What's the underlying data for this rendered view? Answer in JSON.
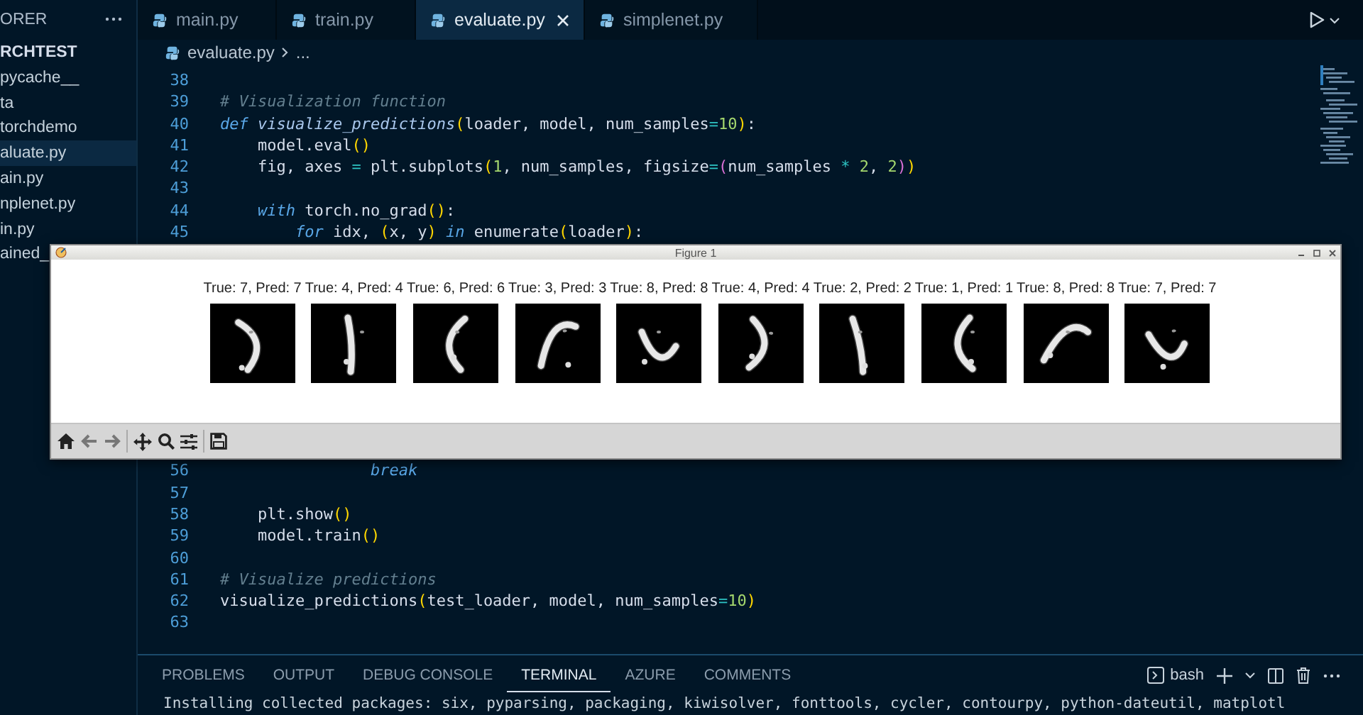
{
  "sidebar": {
    "title": "ORER",
    "root": "RCHTEST",
    "items": [
      {
        "label": "pycache__",
        "selected": false
      },
      {
        "label": "ta",
        "selected": false
      },
      {
        "label": "torchdemo",
        "selected": false
      },
      {
        "label": "aluate.py",
        "selected": true
      },
      {
        "label": "ain.py",
        "selected": false
      },
      {
        "label": "nplenet.py",
        "selected": false
      },
      {
        "label": "in.py",
        "selected": false
      },
      {
        "label": "ained_",
        "selected": false
      }
    ]
  },
  "tabs": [
    {
      "label": "main.py",
      "selected": false
    },
    {
      "label": "train.py",
      "selected": false
    },
    {
      "label": "evaluate.py",
      "selected": true
    },
    {
      "label": "simplenet.py",
      "selected": false
    }
  ],
  "breadcrumb": [
    "evaluate.py",
    "..."
  ],
  "editor": {
    "lines": [
      {
        "number": "38"
      },
      {
        "number": "39",
        "tokens": [
          {
            "text": "# Visualization function",
            "kind": "comment"
          }
        ]
      },
      {
        "number": "40",
        "tokens": [
          {
            "text": "def",
            "kind": "keyword"
          },
          {
            "text": " visualize_predictions",
            "kind": "function"
          },
          {
            "text": "(",
            "kind": "paren"
          },
          {
            "text": "loader, model, num_samples",
            "kind": "plain"
          },
          {
            "text": "=",
            "kind": "operator"
          },
          {
            "text": "10",
            "kind": "number"
          },
          {
            "text": ")",
            "kind": "paren"
          },
          {
            "text": ":",
            "kind": "plain"
          }
        ]
      },
      {
        "number": "41",
        "tokens": [
          {
            "text": "    model.eval",
            "kind": "plain"
          },
          {
            "text": "()",
            "kind": "paren"
          }
        ]
      },
      {
        "number": "42",
        "tokens": [
          {
            "text": "    fig, axes ",
            "kind": "plain"
          },
          {
            "text": "=",
            "kind": "operator"
          },
          {
            "text": " plt.subplots",
            "kind": "plain"
          },
          {
            "text": "(",
            "kind": "paren"
          },
          {
            "text": "1",
            "kind": "number"
          },
          {
            "text": ", num_samples, figsize",
            "kind": "plain"
          },
          {
            "text": "=",
            "kind": "operator"
          },
          {
            "text": "(",
            "kind": "paren2"
          },
          {
            "text": "num_samples ",
            "kind": "plain"
          },
          {
            "text": "*",
            "kind": "operator"
          },
          {
            "text": " 2",
            "kind": "number"
          },
          {
            "text": ", ",
            "kind": "plain"
          },
          {
            "text": "2",
            "kind": "number"
          },
          {
            "text": ")",
            "kind": "paren2"
          },
          {
            "text": ")",
            "kind": "paren"
          }
        ]
      },
      {
        "number": "43"
      },
      {
        "number": "44",
        "tokens": [
          {
            "text": "    with",
            "kind": "keyword"
          },
          {
            "text": " torch.no_grad",
            "kind": "plain"
          },
          {
            "text": "()",
            "kind": "paren"
          },
          {
            "text": ":",
            "kind": "plain"
          }
        ]
      },
      {
        "number": "45",
        "tokens": [
          {
            "text": "        for",
            "kind": "keyword"
          },
          {
            "text": " idx, ",
            "kind": "plain"
          },
          {
            "text": "(",
            "kind": "paren"
          },
          {
            "text": "x, y",
            "kind": "plain"
          },
          {
            "text": ")",
            "kind": "paren"
          },
          {
            "text": " in",
            "kind": "keyword"
          },
          {
            "text": " enumerate",
            "kind": "plain"
          },
          {
            "text": "(",
            "kind": "paren"
          },
          {
            "text": "loader",
            "kind": "plain"
          },
          {
            "text": ")",
            "kind": "paren"
          },
          {
            "text": ":",
            "kind": "plain"
          }
        ]
      },
      {
        "number": "56",
        "tokens": [
          {
            "text": "                break",
            "kind": "keyword"
          }
        ]
      },
      {
        "number": "57"
      },
      {
        "number": "58",
        "tokens": [
          {
            "text": "    plt.show",
            "kind": "plain"
          },
          {
            "text": "()",
            "kind": "paren"
          }
        ]
      },
      {
        "number": "59",
        "tokens": [
          {
            "text": "    model.train",
            "kind": "plain"
          },
          {
            "text": "()",
            "kind": "paren"
          }
        ]
      },
      {
        "number": "60"
      },
      {
        "number": "61",
        "tokens": [
          {
            "text": "# Visualize predictions",
            "kind": "comment"
          }
        ]
      },
      {
        "number": "62",
        "tokens": [
          {
            "text": "visualize_predictions",
            "kind": "plain"
          },
          {
            "text": "(",
            "kind": "paren"
          },
          {
            "text": "test_loader, model, num_samples",
            "kind": "plain"
          },
          {
            "text": "=",
            "kind": "operator"
          },
          {
            "text": "10",
            "kind": "number"
          },
          {
            "text": ")",
            "kind": "paren"
          }
        ]
      },
      {
        "number": "63"
      }
    ]
  },
  "figure_window": {
    "title": "Figure 1",
    "samples": [
      {
        "title": "True: 7, Pred: 7",
        "kind": "picture"
      },
      {
        "title": "True: 4, Pred: 4",
        "kind": "picture"
      },
      {
        "title": "True: 6, Pred: 6",
        "kind": "picture"
      },
      {
        "title": "True: 3, Pred: 3",
        "kind": "picture"
      },
      {
        "title": "True: 8, Pred: 8",
        "kind": "picture"
      },
      {
        "title": "True: 4, Pred: 4",
        "kind": "picture"
      },
      {
        "title": "True: 2, Pred: 2",
        "kind": "picture"
      },
      {
        "title": "True: 1, Pred: 1",
        "kind": "picture"
      },
      {
        "title": "True: 8, Pred: 8",
        "kind": "picture"
      },
      {
        "title": "True: 7, Pred: 7",
        "kind": "picture"
      }
    ]
  },
  "panel": {
    "tabs": [
      {
        "label": "PROBLEMS",
        "selected": false
      },
      {
        "label": "OUTPUT",
        "selected": false
      },
      {
        "label": "DEBUG CONSOLE",
        "selected": false
      },
      {
        "label": "TERMINAL",
        "selected": true
      },
      {
        "label": "AZURE",
        "selected": false
      },
      {
        "label": "COMMENTS",
        "selected": false
      }
    ],
    "shell": "bash",
    "terminal_output": "Installing collected packages: six, pyparsing, packaging, kiwisolver, fonttools, cycler, contourpy, python-dateutil, matplotl"
  }
}
